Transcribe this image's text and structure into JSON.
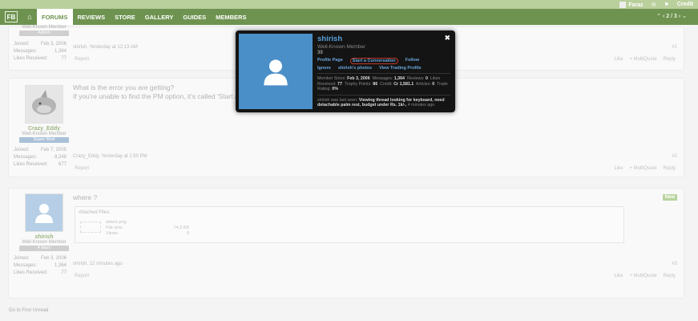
{
  "topbar": {
    "user": "Faraz",
    "credit": "Credit"
  },
  "nav": {
    "logo": "FB",
    "items": [
      "FORUMS",
      "REVIEWS",
      "STORE",
      "GALLERY",
      "GUIDES",
      "MEMBERS"
    ],
    "pager": "2 / 3"
  },
  "posts": [
    {
      "user": {
        "title": "Well-Known Member",
        "banner": "Admin",
        "joined_label": "Joined:",
        "joined": "Feb 3, 2006",
        "messages_label": "Messages:",
        "messages": "1,364",
        "likes_label": "Likes Received:",
        "likes": "77"
      },
      "meta": "shirish, Yesterday at 12:13 AM",
      "number": "#1",
      "report": "Report",
      "like": "Like",
      "multiquote": "+ MultiQuote",
      "reply": "Reply"
    },
    {
      "message_line1": "What is the error you are getting?",
      "message_line2": "If you're unable to find the PM option, it's called 'Start a Conve",
      "user": {
        "name": "Crazy_Eddy",
        "title": "Well-Known Member",
        "banner": "Super Mod",
        "joined_label": "Joined:",
        "joined": "Feb 7, 2005",
        "messages_label": "Messages:",
        "messages": "8,248",
        "likes_label": "Likes Received:",
        "likes": "677"
      },
      "meta": "Crazy_Eddy, Yesterday at 1:50 PM",
      "number": "#2",
      "report": "Report",
      "like": "Like",
      "multiquote": "+ MultiQuote",
      "reply": "Reply"
    },
    {
      "message": "where ?",
      "badge": "New",
      "attached_files": "Attached Files:",
      "file": {
        "name": "where.png",
        "size_label": "File size:",
        "size": "74.2 KB",
        "views_label": "Views:",
        "views": "0"
      },
      "user": {
        "name": "shirish",
        "title": "Well-Known Member",
        "banner": "4 days",
        "joined_label": "Joined:",
        "joined": "Feb 3, 2006",
        "messages_label": "Messages:",
        "messages": "1,364",
        "likes_label": "Likes Received:",
        "likes": "77"
      },
      "meta": "shirish, 12 minutes ago",
      "number": "#3",
      "report": "Report",
      "like": "Like",
      "multiquote": "+ MultiQuote",
      "reply": "Reply"
    }
  ],
  "go_first_unread": "Go to First Unread",
  "popup": {
    "name": "shirish",
    "title": "Well-Known Member",
    "count": "39",
    "links": {
      "profile": "Profile Page",
      "conversation": "Start a Conversation",
      "follow": "Follow",
      "ignore": "Ignore",
      "photos": "shirish's photos",
      "trading": "View Trading Profile"
    },
    "stats": {
      "member_since_label": "Member Since:",
      "member_since": "Feb 3, 2006",
      "messages_label": "Messages:",
      "messages": "1,364",
      "reviews_label": "Reviews:",
      "reviews": "0",
      "likes_label": "Likes Received:",
      "likes": "77",
      "trophy_label": "Trophy Points:",
      "trophy": "86",
      "credit_label": "Credit:",
      "credit": "Cr 1,581.1",
      "articles_label": "Articles:",
      "articles": "0",
      "trade_label": "Trade Rating:",
      "trade": "0%"
    },
    "status_prefix": "shirish was last seen:",
    "status_text": "Viewing thread looking for keyboard, need detachable palm rest, budget under Rs. 1k/-,",
    "status_time": "4 minutes ago",
    "close": "✖"
  }
}
